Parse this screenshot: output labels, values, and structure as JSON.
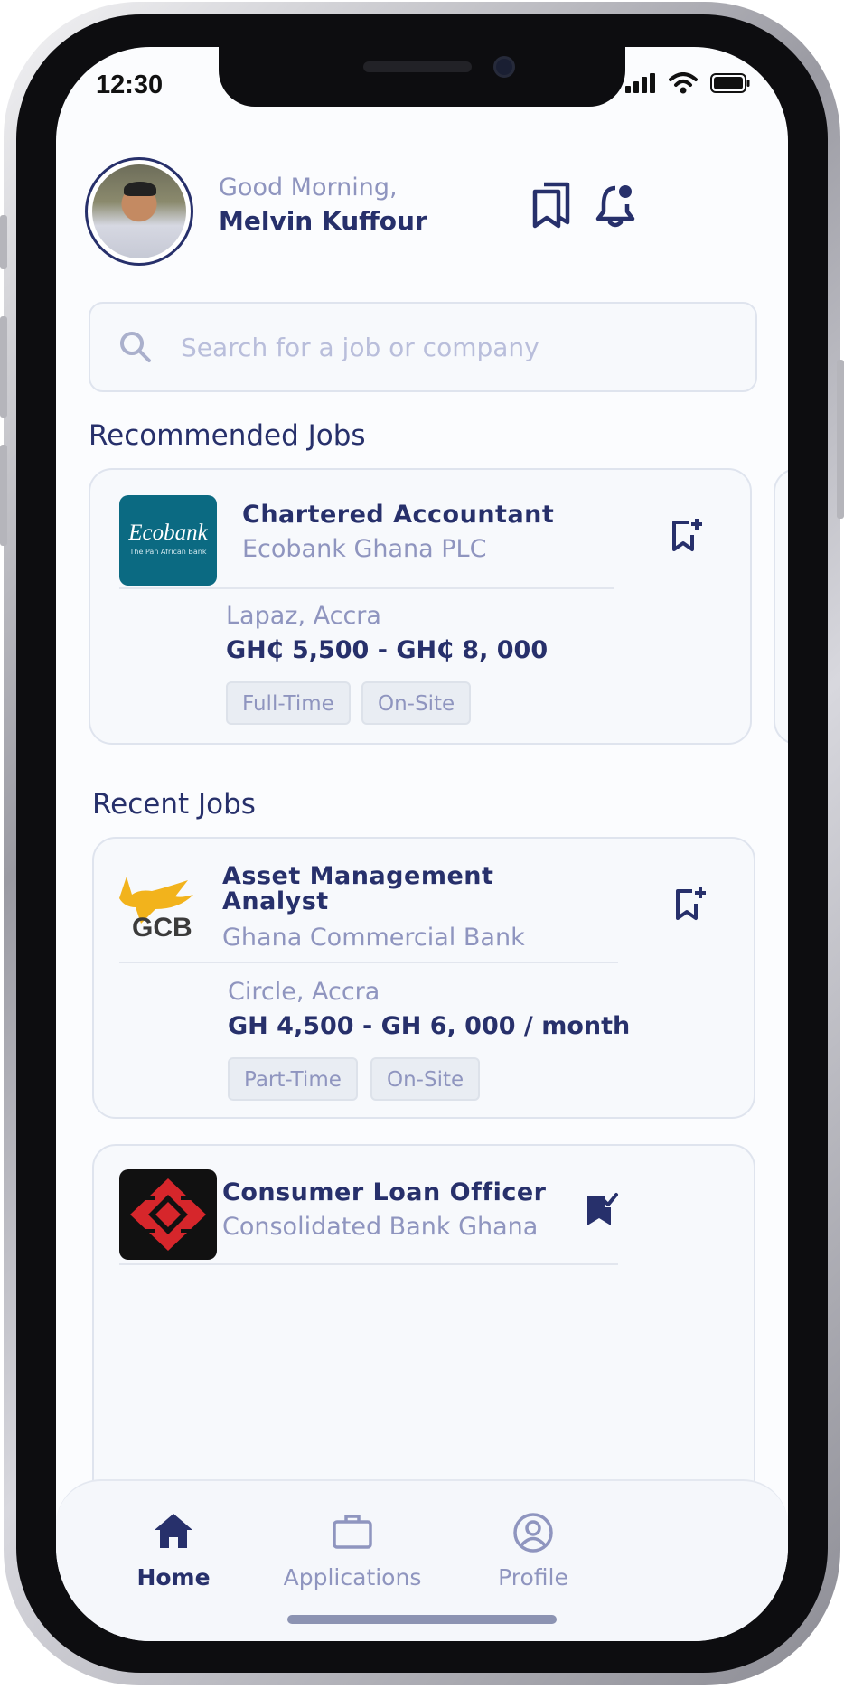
{
  "status_bar": {
    "time": "12:30"
  },
  "header": {
    "greeting": "Good Morning,",
    "user_name": "Melvin Kuffour"
  },
  "search": {
    "placeholder": "Search for a job or company"
  },
  "recommended": {
    "title": "Recommended Jobs",
    "jobs": [
      {
        "title": "Chartered Accountant",
        "company": "Ecobank Ghana PLC",
        "logo_text": "Ecobank",
        "logo_tagline": "The Pan African Bank",
        "location": "Lapaz, Accra",
        "salary": "GH₵ 5,500 - GH₵ 8, 000",
        "tags": [
          "Full-Time",
          "On-Site"
        ],
        "saved": false
      }
    ]
  },
  "recent": {
    "title": "Recent Jobs",
    "jobs": [
      {
        "title_line1": "Asset Management",
        "title_line2": "Analyst",
        "company": "Ghana Commercial Bank",
        "logo_text": "GCB",
        "location": "Circle, Accra",
        "salary": "GH 4,500 - GH 6, 000 / month",
        "tags": [
          "Part-Time",
          "On-Site"
        ],
        "saved": false
      },
      {
        "title": "Consumer Loan Officer",
        "company": "Consolidated Bank Ghana",
        "saved": true
      }
    ]
  },
  "bottom_nav": {
    "items": [
      {
        "label": "Home",
        "icon": "home-icon",
        "active": true
      },
      {
        "label": "Applications",
        "icon": "briefcase-icon",
        "active": false
      },
      {
        "label": "Profile",
        "icon": "user-circle-icon",
        "active": false
      }
    ]
  },
  "colors": {
    "primary": "#27306b",
    "muted": "#8f95bf",
    "card_bg": "#f7f9fc",
    "ecobank_teal": "#0b6a82",
    "gcb_gold": "#f2b31c"
  }
}
